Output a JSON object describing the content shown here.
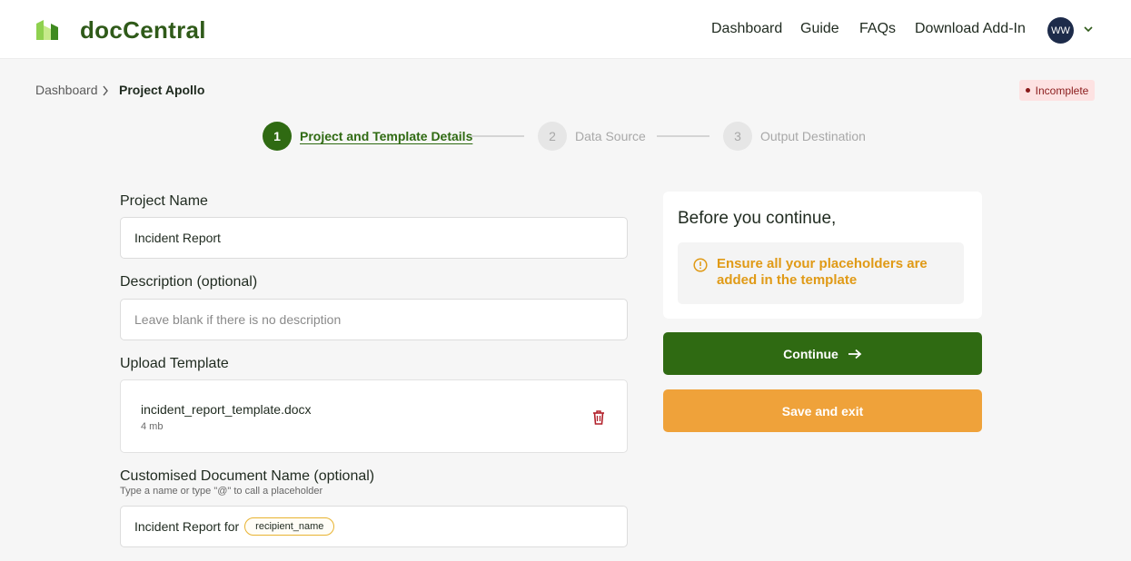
{
  "header": {
    "brand": "docCentral",
    "nav": [
      "Dashboard",
      "Guide",
      "FAQs",
      "Download Add-In"
    ],
    "user_initials": "WW",
    "brand_color": "#2f5a19"
  },
  "breadcrumb": {
    "root": "Dashboard",
    "current": "Project Apollo"
  },
  "status": {
    "label": "Incomplete",
    "color": "#8a1b1b"
  },
  "stepper": {
    "steps": [
      {
        "number": "1",
        "label": "Project and Template Details",
        "state": "active"
      },
      {
        "number": "2",
        "label": "Data Source",
        "state": "inactive"
      },
      {
        "number": "3",
        "label": "Output Destination",
        "state": "inactive"
      }
    ]
  },
  "form": {
    "project_name_label": "Project Name",
    "project_name_value": "Incident Report",
    "description_label": "Description (optional)",
    "description_placeholder": "Leave blank if there is no description",
    "upload_label": "Upload Template",
    "file_name": "incident_report_template.docx",
    "file_size": "4 mb",
    "docname_label": "Customised Document Name (optional)",
    "docname_hint": "Type a name or type \"@\" to call a placeholder",
    "docname_text": "Incident Report for",
    "docname_placeholder_chip": "recipient_name"
  },
  "panel": {
    "title": "Before you continue,",
    "warning": "Ensure all your placeholders are added in the template",
    "warning_color": "#e09a16"
  },
  "actions": {
    "continue_label": "Continue",
    "save_label": "Save and exit",
    "continue_color": "#2f6a12",
    "save_color": "#efa23a"
  }
}
